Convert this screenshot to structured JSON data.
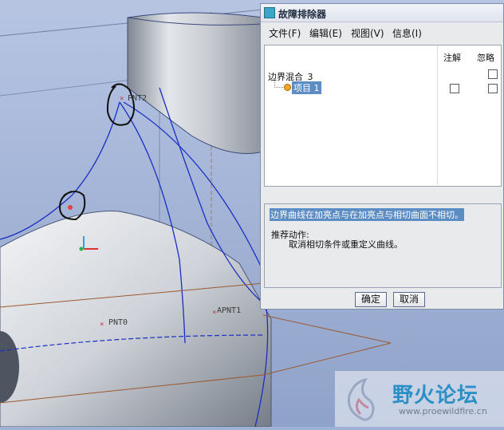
{
  "viewport": {
    "point_labels": [
      "PNT2",
      "PNT0",
      "APNT1"
    ]
  },
  "dialog": {
    "title": "故障排除器",
    "menu": [
      "文件(F)",
      "编辑(E)",
      "视图(V)",
      "信息(I)"
    ],
    "columns": {
      "annotate": "注解",
      "ignore": "忽略"
    },
    "tree": {
      "root": "边界混合_3",
      "item": "项目 1"
    },
    "message": "边界曲线在加亮点与在加亮点与相切曲面不相切。",
    "action_heading": "推荐动作:",
    "action_text": "取消相切条件或重定义曲线。",
    "ok_label": "确定",
    "cancel_label": "取消"
  },
  "watermark": {
    "title": "野火论坛",
    "url": "www.proewildfire.cn"
  }
}
